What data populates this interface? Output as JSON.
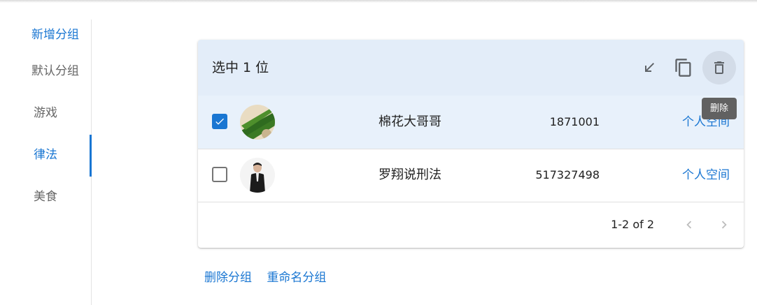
{
  "sidebar": {
    "add_group": "新增分组",
    "items": [
      {
        "label": "默认分组"
      },
      {
        "label": "游戏"
      },
      {
        "label": "律法"
      },
      {
        "label": "美食"
      }
    ],
    "active_item": "律法"
  },
  "toolbar": {
    "selection_text": "选中 1 位",
    "tooltip": "删除",
    "icons": [
      "move-to-icon",
      "copy-icon",
      "delete-icon"
    ]
  },
  "rows": [
    {
      "name": "棉花大哥哥",
      "id": "1871001",
      "link": "个人空间",
      "selected": true
    },
    {
      "name": "罗翔说刑法",
      "id": "517327498",
      "link": "个人空间",
      "selected": false
    }
  ],
  "pagination": {
    "range_text": "1-2 of 2"
  },
  "group_actions": {
    "delete_label": "删除分组",
    "rename_label": "重命名分组"
  },
  "colors": {
    "accent": "#1976d2",
    "toolbar_bg": "#e3edf9",
    "selected_row_bg": "#e8f1fb"
  }
}
